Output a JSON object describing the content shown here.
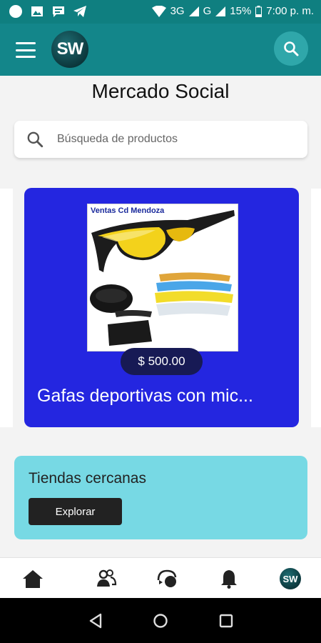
{
  "status_bar": {
    "network": "3G",
    "network2": "G",
    "battery": "15%",
    "time": "7:00 p. m."
  },
  "app_bar": {
    "logo_text": "SW"
  },
  "page": {
    "title": "Mercado Social"
  },
  "search": {
    "placeholder": "Búsqueda de productos"
  },
  "featured_product": {
    "image_caption": "Ventas Cd Mendoza",
    "price": "$ 500.00",
    "name": "Gafas deportivas con mic..."
  },
  "nearby_stores": {
    "title": "Tiendas cercanas",
    "button_label": "Explorar"
  },
  "bottom_nav": {
    "avatar_text": "SW",
    "items": [
      "home-icon",
      "people-icon",
      "chat-icon",
      "bell-icon",
      "profile-avatar"
    ]
  },
  "colors": {
    "status_bar": "#0f7f80",
    "app_bar": "#13868a",
    "product_card": "#2426e0",
    "stores_card": "#77d9e4"
  }
}
